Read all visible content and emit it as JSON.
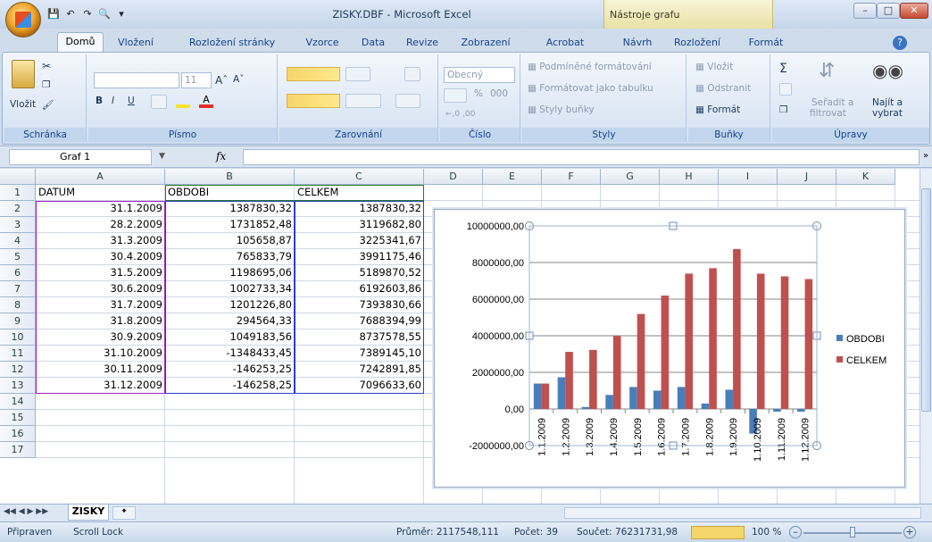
{
  "titlebar": {
    "title": "ZISKY.DBF - Microsoft Excel",
    "chart_tools": "Nástroje grafu"
  },
  "tabs": [
    "Domů",
    "Vložení",
    "Rozložení stránky",
    "Vzorce",
    "Data",
    "Revize",
    "Zobrazení",
    "Acrobat",
    "Návrh",
    "Rozložení",
    "Formát"
  ],
  "ribbon": {
    "clipboard": {
      "label": "Schránka",
      "paste": "Vložit"
    },
    "font": {
      "label": "Písmo",
      "size": "11"
    },
    "alignment": {
      "label": "Zarovnání"
    },
    "number": {
      "label": "Číslo",
      "format": "Obecný",
      "percent": "%",
      "thousands": "000"
    },
    "styles": {
      "label": "Styly",
      "conditional": "Podmíněné formátování",
      "as_table": "Formátovat jako tabulku",
      "cell_styles": "Styly buňky"
    },
    "cells": {
      "label": "Buňky",
      "insert": "Vložit",
      "delete": "Odstranit",
      "format": "Formát"
    },
    "editing": {
      "label": "Úpravy",
      "sort": "Seřadit a",
      "sort2": "filtrovat",
      "find": "Najít a",
      "find2": "vybrat"
    }
  },
  "formula_bar": {
    "name_box": "Graf 1",
    "fx": "fx",
    "content": ""
  },
  "columns": [
    "A",
    "B",
    "C",
    "D",
    "E",
    "F",
    "G",
    "H",
    "I",
    "J",
    "K"
  ],
  "rows": [
    "1",
    "2",
    "3",
    "4",
    "5",
    "6",
    "7",
    "8",
    "9",
    "10",
    "11",
    "12",
    "13",
    "14",
    "15",
    "16",
    "17"
  ],
  "table": {
    "headers": [
      "DATUM",
      "OBDOBI",
      "CELKEM"
    ],
    "data": [
      [
        "31.1.2009",
        "1387830,32",
        "1387830,32"
      ],
      [
        "28.2.2009",
        "1731852,48",
        "3119682,80"
      ],
      [
        "31.3.2009",
        "105658,87",
        "3225341,67"
      ],
      [
        "30.4.2009",
        "765833,79",
        "3991175,46"
      ],
      [
        "31.5.2009",
        "1198695,06",
        "5189870,52"
      ],
      [
        "30.6.2009",
        "1002733,34",
        "6192603,86"
      ],
      [
        "31.7.2009",
        "1201226,80",
        "7393830,66"
      ],
      [
        "31.8.2009",
        "294564,33",
        "7688394,99"
      ],
      [
        "30.9.2009",
        "1049183,56",
        "8737578,55"
      ],
      [
        "31.10.2009",
        "-1348433,45",
        "7389145,10"
      ],
      [
        "30.11.2009",
        "-146253,25",
        "7242891,85"
      ],
      [
        "31.12.2009",
        "-146258,25",
        "7096633,60"
      ]
    ]
  },
  "chart_data": {
    "type": "bar",
    "categories": [
      "1.1.2009",
      "1.2.2009",
      "1.3.2009",
      "1.4.2009",
      "1.5.2009",
      "1.6.2009",
      "1.7.2009",
      "1.8.2009",
      "1.9.2009",
      "1.10.2009",
      "1.11.2009",
      "1.12.2009"
    ],
    "series": [
      {
        "name": "OBDOBI",
        "color": "#4a7ebb",
        "values": [
          1387830.32,
          1731852.48,
          105658.87,
          765833.79,
          1198695.06,
          1002733.34,
          1201226.8,
          294564.33,
          1049183.56,
          -1348433.45,
          -146253.25,
          -146258.25
        ]
      },
      {
        "name": "CELKEM",
        "color": "#c0504d",
        "values": [
          1387830.32,
          3119682.8,
          3225341.67,
          3991175.46,
          5189870.52,
          6192603.86,
          7393830.66,
          7688394.99,
          8737578.55,
          7389145.1,
          7242891.85,
          7096633.6
        ]
      }
    ],
    "yticks": [
      "10000000,00",
      "8000000,00",
      "6000000,00",
      "4000000,00",
      "2000000,00",
      "0,00",
      "-2000000,00"
    ],
    "ylim": [
      -2000000,
      10000000
    ],
    "grid": true,
    "legend": "right"
  },
  "sheet_tabs": {
    "active": "ZISKY"
  },
  "status": {
    "ready": "Připraven",
    "scroll_lock": "Scroll Lock",
    "average": "Průměr: 2117548,111",
    "count": "Počet: 39",
    "sum": "Součet: 76231731,98",
    "zoom": "100 %"
  }
}
